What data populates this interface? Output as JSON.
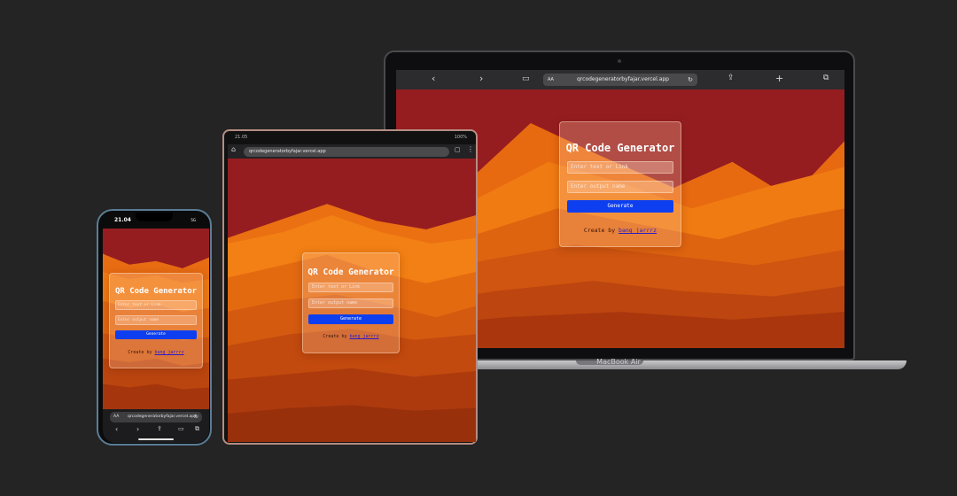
{
  "app": {
    "title": "QR Code Generator",
    "input_placeholder": "Enter text or Link",
    "output_placeholder": "Enter output name",
    "generate_label": "Generate",
    "credit_prefix": "Create by ",
    "credit_link": "bang_jarrrz"
  },
  "laptop": {
    "url": "qrcodegeneratorbyfajar.vercel.app",
    "aa_label": "AA",
    "label": "MacBook Air",
    "icons": [
      "back-icon",
      "forward-icon",
      "book-icon",
      "reload-icon",
      "share-icon",
      "new-tab-icon",
      "tabs-icon"
    ]
  },
  "tablet": {
    "url": "qrcodegeneratorbyfajar.vercel.app",
    "time": "21.05",
    "battery": "100%"
  },
  "phone": {
    "time": "21.04",
    "signal": "5G",
    "aa_label": "AA",
    "url": "qrcodegenerato​rbyfajar.vercel.app"
  },
  "colors": {
    "sky": "#951d20",
    "button": "#0d3ff0",
    "link": "#2b1cc9"
  }
}
